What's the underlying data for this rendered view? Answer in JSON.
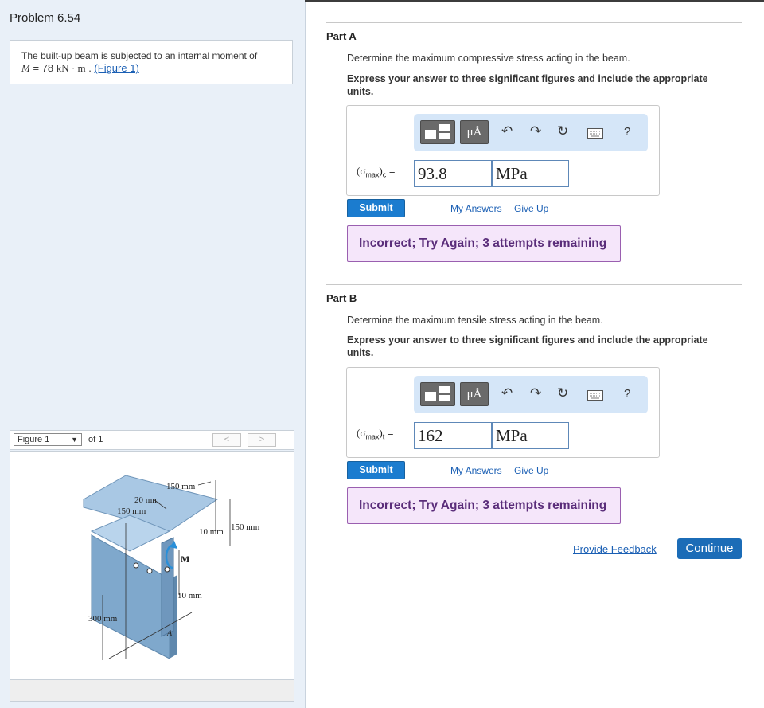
{
  "problem": {
    "title": "Problem 6.54",
    "statement_text": "The built-up beam is subjected to an internal moment of",
    "moment_symbol": "M",
    "moment_eq": " = 78 ",
    "moment_unit": "kN · m",
    "figure_link": "(Figure 1)"
  },
  "figure": {
    "select_label": "Figure 1",
    "of_label": "of 1",
    "prev": "<",
    "next": ">",
    "labels": {
      "dim_150_top": "150 mm",
      "dim_20": "20 mm",
      "dim_150_left": "150 mm",
      "dim_10_a": "10 mm",
      "dim_150_right": "150 mm",
      "moment": "M",
      "dim_10_b": "10 mm",
      "dim_300": "300 mm",
      "point_a": "A"
    }
  },
  "toolbar": {
    "unit_button": "μÅ",
    "help": "?",
    "icons": [
      "templates-icon",
      "units-icon",
      "undo-icon",
      "redo-icon",
      "reset-icon",
      "keyboard-icon",
      "help-icon"
    ]
  },
  "partA": {
    "title": "Part A",
    "question": "Determine the maximum compressive stress acting in the beam.",
    "instructions": "Express your answer to three significant figures and include the appropriate units.",
    "label_sigma": "(σ",
    "label_sub": "max",
    "label_close": ")",
    "label_sub2": "c",
    "label_eq": " =",
    "value": "93.8",
    "unit": "MPa",
    "submit": "Submit",
    "my_answers": "My Answers",
    "give_up": "Give Up",
    "feedback": "Incorrect; Try Again; 3 attempts remaining"
  },
  "partB": {
    "title": "Part B",
    "question": "Determine the maximum tensile stress acting in the beam.",
    "instructions": "Express your answer to three significant figures and include the appropriate units.",
    "label_sigma": "(σ",
    "label_sub": "max",
    "label_close": ")",
    "label_sub2": "t",
    "label_eq": " =",
    "value": "162",
    "unit": "MPa",
    "submit": "Submit",
    "my_answers": "My Answers",
    "give_up": "Give Up",
    "feedback": "Incorrect; Try Again; 3 attempts remaining"
  },
  "footer": {
    "provide_feedback": "Provide Feedback",
    "continue": "Continue"
  },
  "colors": {
    "accent": "#1b7ccf",
    "panel_bg": "#e9f0f8",
    "feedback_bg": "#f5e6fa",
    "feedback_text": "#5a2d7a",
    "beam": "#8fb3d2"
  }
}
